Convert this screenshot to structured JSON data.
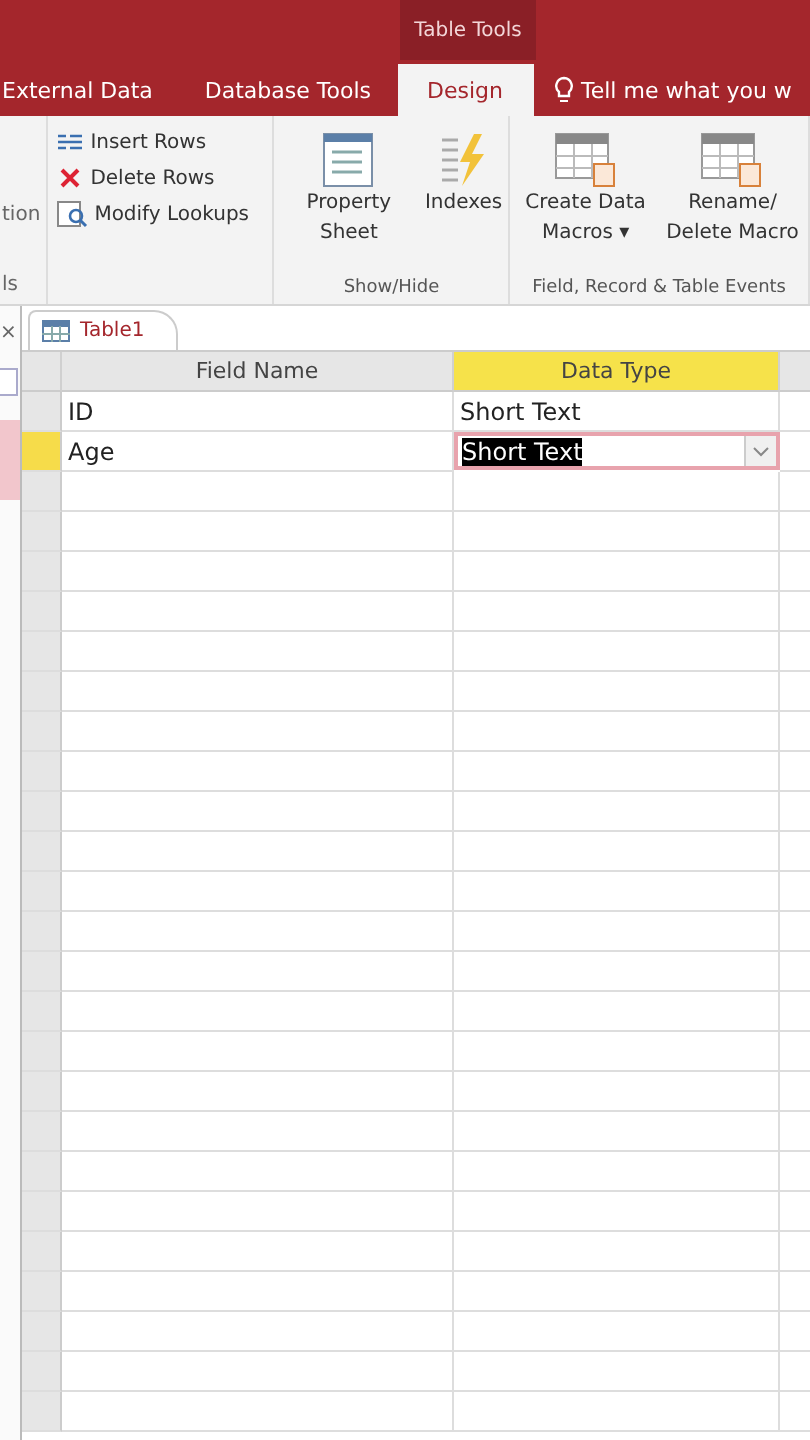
{
  "contextual_tab": {
    "title": "Table Tools"
  },
  "tabs": [
    {
      "label": "External Data",
      "selected": false
    },
    {
      "label": "Database Tools",
      "selected": false
    },
    {
      "label": "Design",
      "selected": true
    }
  ],
  "tell_me": {
    "text": "Tell me what you w"
  },
  "nav_pane": {
    "close": "×"
  },
  "ribbon": {
    "cut_label": "tion",
    "cut_group_label": "ls",
    "tools": [
      "Insert Rows",
      "Delete Rows",
      "Modify Lookups"
    ],
    "groups": [
      {
        "label": "Show/Hide",
        "buttons": [
          {
            "kind": "sheet",
            "label": "Property Sheet"
          },
          {
            "kind": "bolt",
            "label": "Indexes"
          }
        ]
      },
      {
        "label": "Field, Record & Table Events",
        "buttons": [
          {
            "kind": "table",
            "label": "Create Data Macros ▾"
          },
          {
            "kind": "table",
            "label": "Rename/ Delete Macro"
          }
        ]
      }
    ]
  },
  "document_tab": {
    "label": "Table1"
  },
  "table": {
    "columns": [
      "Field Name",
      "Data Type"
    ],
    "rows": [
      {
        "field_name": "ID",
        "data_type": "Short Text",
        "selected": false
      },
      {
        "field_name": "Age",
        "data_type": "Short Text",
        "selected": true
      }
    ]
  }
}
